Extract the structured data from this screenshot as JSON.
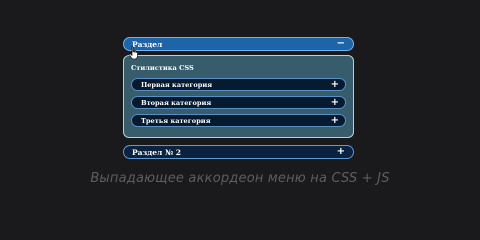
{
  "accordion": {
    "section1": {
      "label": "Раздел",
      "toggle": "−",
      "subtitle": "Стилистика CSS",
      "items": [
        {
          "label": "Первая категория",
          "toggle": "+"
        },
        {
          "label": "Вторая категория",
          "toggle": "+"
        },
        {
          "label": "Третья категория",
          "toggle": "+"
        }
      ]
    },
    "section2": {
      "label": "Раздел № 2",
      "toggle": "+"
    }
  },
  "caption": "Выпадающее аккордеон меню на CSS + JS",
  "colors": {
    "background": "#1a1a1c",
    "open_header": "#1d64a8",
    "panel": "#375d6c",
    "item": "#071b30"
  },
  "icons": {
    "cursor": "hand-pointer-icon"
  }
}
